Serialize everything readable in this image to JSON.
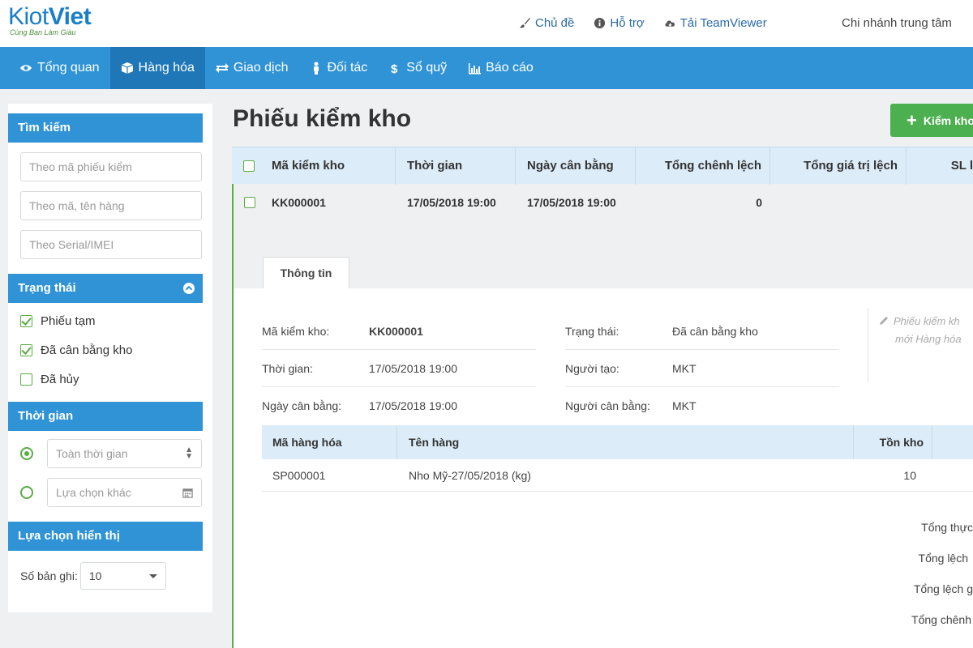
{
  "brand": {
    "name_part1": "Kiot",
    "name_part2": "Viet",
    "tagline": "Cùng Bạn Làm Giàu"
  },
  "top_links": [
    {
      "label": "Chủ đề",
      "icon": "brush-icon"
    },
    {
      "label": "Hỗ trợ",
      "icon": "info-icon"
    },
    {
      "label": "Tải TeamViewer",
      "icon": "cloud-icon"
    }
  ],
  "branch": "Chi nhánh trung tâm",
  "nav": [
    {
      "label": "Tổng quan",
      "icon": "eye-icon",
      "active": false
    },
    {
      "label": "Hàng hóa",
      "icon": "box-icon",
      "active": true
    },
    {
      "label": "Giao dịch",
      "icon": "exchange-icon",
      "active": false
    },
    {
      "label": "Đối tác",
      "icon": "person-icon",
      "active": false
    },
    {
      "label": "Sổ quỹ",
      "icon": "dollar-icon",
      "active": false
    },
    {
      "label": "Báo cáo",
      "icon": "bar-chart-icon",
      "active": false
    }
  ],
  "sidebar": {
    "search": {
      "title": "Tìm kiếm",
      "placeholders": [
        "Theo mã phiếu kiểm",
        "Theo mã, tên hàng",
        "Theo Serial/IMEI"
      ]
    },
    "status": {
      "title": "Trạng thái",
      "options": [
        {
          "label": "Phiếu tạm",
          "checked": true
        },
        {
          "label": "Đã cân bằng kho",
          "checked": true
        },
        {
          "label": "Đã hủy",
          "checked": false
        }
      ]
    },
    "time": {
      "title": "Thời gian",
      "options": [
        {
          "label": "Toàn thời gian",
          "selected": true
        },
        {
          "label": "Lựa chọn khác",
          "selected": false
        }
      ]
    },
    "display": {
      "title": "Lựa chọn hiển thị",
      "records_label": "Số bản ghi:",
      "records_value": "10"
    }
  },
  "main": {
    "title": "Phiếu kiểm kho",
    "add_button": "Kiểm kho",
    "columns": [
      "Mã kiểm kho",
      "Thời gian",
      "Ngày cân bằng",
      "Tổng chênh lệch",
      "Tổng giá trị lệch",
      "SL l"
    ],
    "row": {
      "code": "KK000001",
      "time": "17/05/2018 19:00",
      "balance_date": "17/05/2018 19:00",
      "total_diff": "0"
    },
    "detail": {
      "tab": "Thông tin",
      "fields_left": [
        {
          "label": "Mã kiểm kho:",
          "value": "KK000001"
        },
        {
          "label": "Thời gian:",
          "value": "17/05/2018 19:00"
        },
        {
          "label": "Ngày cân bằng:",
          "value": "17/05/2018 19:00"
        }
      ],
      "fields_right": [
        {
          "label": "Trạng thái:",
          "value": "Đã cân bằng kho"
        },
        {
          "label": "Người tạo:",
          "value": "MKT"
        },
        {
          "label": "Người cân bằng:",
          "value": "MKT"
        }
      ],
      "note_line1": "Phiếu kiểm kh",
      "note_line2": "mới Hàng hóa",
      "item_columns": [
        "Mã hàng hóa",
        "Tên hàng",
        "Tồn kho"
      ],
      "items": [
        {
          "code": "SP000001",
          "name": "Nho Mỹ-27/05/2018 (kg)",
          "stock": "10"
        }
      ],
      "totals": [
        "Tổng thực",
        "Tổng lệch",
        "Tổng lệch g",
        "Tổng chênh"
      ]
    }
  }
}
